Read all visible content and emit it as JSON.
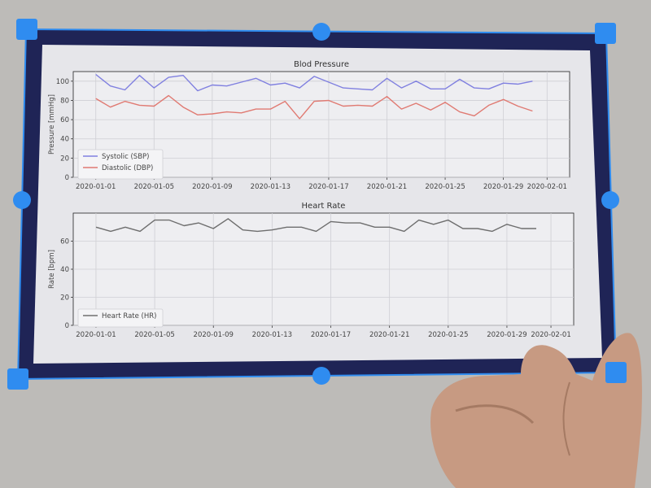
{
  "colors": {
    "systolic": "#8080e0",
    "diastolic": "#e07a72",
    "heart_rate": "#6e6e6e",
    "frame": "#1f2456",
    "handle": "#2f8cf0",
    "paper": "#e6e6ea"
  },
  "chart_data": [
    {
      "type": "line",
      "title": "Blod Pressure",
      "xlabel": "",
      "ylabel": "Pressure [mmHg]",
      "x": [
        "2020-01-01",
        "2020-01-02",
        "2020-01-03",
        "2020-01-04",
        "2020-01-05",
        "2020-01-06",
        "2020-01-07",
        "2020-01-08",
        "2020-01-09",
        "2020-01-10",
        "2020-01-11",
        "2020-01-12",
        "2020-01-13",
        "2020-01-14",
        "2020-01-15",
        "2020-01-16",
        "2020-01-17",
        "2020-01-18",
        "2020-01-19",
        "2020-01-20",
        "2020-01-21",
        "2020-01-22",
        "2020-01-23",
        "2020-01-24",
        "2020-01-25",
        "2020-01-26",
        "2020-01-27",
        "2020-01-28",
        "2020-01-29",
        "2020-01-30",
        "2020-01-31"
      ],
      "series": [
        {
          "name": "Systolic (SBP)",
          "values": [
            107,
            95,
            91,
            106,
            93,
            104,
            106,
            90,
            96,
            95,
            99,
            103,
            96,
            98,
            93,
            105,
            99,
            93,
            92,
            91,
            103,
            93,
            100,
            92,
            92,
            102,
            93,
            92,
            98,
            97,
            100
          ]
        },
        {
          "name": "Diastolic (DBP)",
          "values": [
            82,
            73,
            79,
            75,
            74,
            85,
            73,
            65,
            66,
            68,
            67,
            71,
            71,
            79,
            61,
            79,
            80,
            74,
            75,
            74,
            84,
            71,
            77,
            70,
            78,
            68,
            64,
            75,
            81,
            74,
            69
          ]
        }
      ],
      "xticks": [
        "2020-01-01",
        "2020-01-05",
        "2020-01-09",
        "2020-01-13",
        "2020-01-17",
        "2020-01-21",
        "2020-01-25",
        "2020-01-29",
        "2020-02-01"
      ],
      "yticks": [
        0,
        20,
        40,
        60,
        80,
        100
      ],
      "xlim": [
        "2020-01-01",
        "2020-02-01"
      ],
      "ylim": [
        0,
        110
      ],
      "grid": true,
      "legend": "lower-left"
    },
    {
      "type": "line",
      "title": "Heart Rate",
      "xlabel": "",
      "ylabel": "Rate [bpm]",
      "x": [
        "2020-01-01",
        "2020-01-02",
        "2020-01-03",
        "2020-01-04",
        "2020-01-05",
        "2020-01-06",
        "2020-01-07",
        "2020-01-08",
        "2020-01-09",
        "2020-01-10",
        "2020-01-11",
        "2020-01-12",
        "2020-01-13",
        "2020-01-14",
        "2020-01-15",
        "2020-01-16",
        "2020-01-17",
        "2020-01-18",
        "2020-01-19",
        "2020-01-20",
        "2020-01-21",
        "2020-01-22",
        "2020-01-23",
        "2020-01-24",
        "2020-01-25",
        "2020-01-26",
        "2020-01-27",
        "2020-01-28",
        "2020-01-29",
        "2020-01-30",
        "2020-01-31"
      ],
      "series": [
        {
          "name": "Heart Rate (HR)",
          "values": [
            70,
            67,
            70,
            67,
            75,
            75,
            71,
            73,
            69,
            76,
            68,
            67,
            68,
            70,
            70,
            67,
            74,
            73,
            73,
            70,
            70,
            67,
            75,
            72,
            75,
            69,
            69,
            67,
            72,
            69,
            69
          ]
        }
      ],
      "xticks": [
        "2020-01-01",
        "2020-01-05",
        "2020-01-09",
        "2020-01-13",
        "2020-01-17",
        "2020-01-21",
        "2020-01-25",
        "2020-01-29",
        "2020-02-01"
      ],
      "yticks": [
        0,
        20,
        40,
        60
      ],
      "xlim": [
        "2020-01-01",
        "2020-02-01"
      ],
      "ylim": [
        0,
        80
      ],
      "grid": true,
      "legend": "lower-left"
    }
  ]
}
